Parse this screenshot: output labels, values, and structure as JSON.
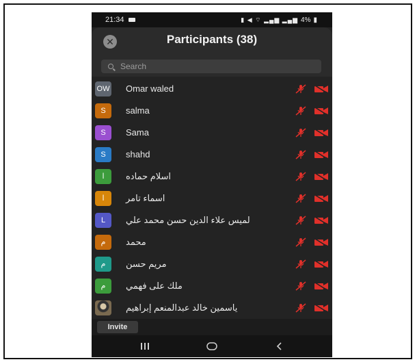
{
  "status_bar": {
    "time": "21:34",
    "battery": "4%"
  },
  "header": {
    "title": "Participants (38)"
  },
  "search": {
    "placeholder": "Search"
  },
  "participants": [
    {
      "name": "Omar waled",
      "initials": "OW",
      "color": "#5f6670"
    },
    {
      "name": "salma",
      "initials": "S",
      "color": "#c56a0c"
    },
    {
      "name": "Sama",
      "initials": "S",
      "color": "#9a4fd0"
    },
    {
      "name": "shahd",
      "initials": "S",
      "color": "#2a7bc6"
    },
    {
      "name": "اسلام حماده",
      "initials": "ا",
      "color": "#3c9c3c"
    },
    {
      "name": "اسماء تامر",
      "initials": "ا",
      "color": "#d7860a"
    },
    {
      "name": "لميس علاء الدين حسن محمد علي",
      "initials": "L",
      "color": "#5458c7"
    },
    {
      "name": "محمد",
      "initials": "م",
      "color": "#c56a0c"
    },
    {
      "name": "مريم حسن",
      "initials": "م",
      "color": "#1f9a8a"
    },
    {
      "name": "ملك على فهمي",
      "initials": "م",
      "color": "#3c9c3c"
    },
    {
      "name": "ياسمين خالد عبدالمنعم إبراهيم",
      "initials": "",
      "color": "#555555",
      "photo": true
    }
  ],
  "icons": {
    "mic": "mic-muted-icon",
    "video": "video-off-icon"
  },
  "colors": {
    "muted_red": "#e0302a"
  },
  "footer": {
    "invite_label": "Invite"
  }
}
